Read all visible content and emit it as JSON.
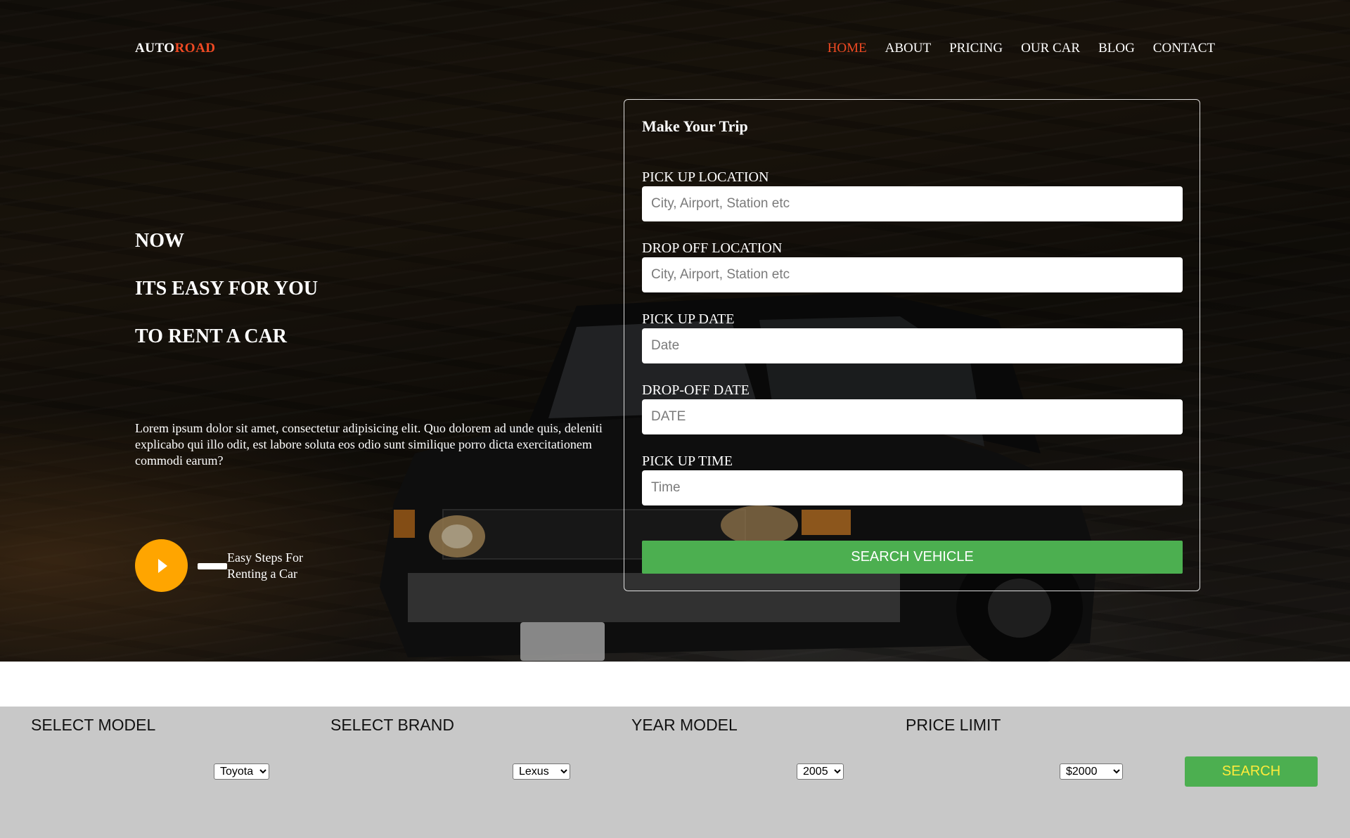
{
  "brand": {
    "part1": "AUTO",
    "part2": "ROAD"
  },
  "nav": {
    "items": [
      {
        "label": "HOME",
        "active": true
      },
      {
        "label": "ABOUT",
        "active": false
      },
      {
        "label": "PRICING",
        "active": false
      },
      {
        "label": "OUR CAR",
        "active": false
      },
      {
        "label": "BLOG",
        "active": false
      },
      {
        "label": "CONTACT",
        "active": false
      }
    ]
  },
  "hero": {
    "headline": [
      "NOW",
      "ITS EASY FOR YOU",
      "TO RENT A CAR"
    ],
    "lead": "Lorem ipsum dolor sit amet, consectetur adipisicing elit. Quo dolorem ad unde quis, deleniti explicabo qui illo odit, est labore soluta eos odio sunt similique porro dicta exercitationem commodi earum?",
    "steps_text": "Easy Steps For Renting a Car",
    "play_icon": "play-icon"
  },
  "trip_form": {
    "title": "Make Your Trip",
    "fields": [
      {
        "label": "PICK UP LOCATION",
        "placeholder": "City, Airport, Station etc",
        "value": ""
      },
      {
        "label": "DROP OFF LOCATION",
        "placeholder": "City, Airport, Station etc",
        "value": ""
      },
      {
        "label": "PICK UP DATE",
        "placeholder": "Date",
        "value": ""
      },
      {
        "label": "DROP-OFF DATE",
        "placeholder": "DATE",
        "value": ""
      },
      {
        "label": "PICK UP TIME",
        "placeholder": "Time",
        "value": ""
      }
    ],
    "submit_label": "SEARCH VEHICLE"
  },
  "filters": {
    "model": {
      "label": "SELECT MODEL",
      "selected": "Toyota"
    },
    "brand": {
      "label": "SELECT BRAND",
      "selected": "Lexus"
    },
    "year": {
      "label": "YEAR MODEL",
      "selected": "2005"
    },
    "price": {
      "label": "PRICE LIMIT",
      "selected": "$2000"
    },
    "search_label": "SEARCH"
  },
  "colors": {
    "accent": "#f04a23",
    "play_button": "#ffa500",
    "primary_button": "#4caf50",
    "search_text": "#ffeb3b",
    "filter_bar": "#c8c8c8"
  }
}
